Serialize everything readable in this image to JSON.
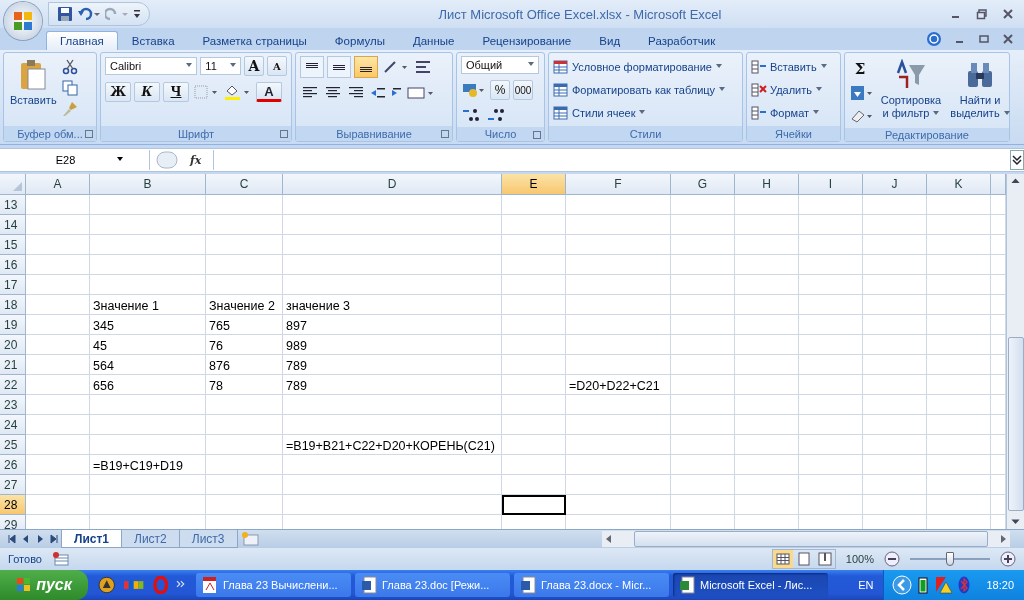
{
  "window": {
    "title": "Лист Microsoft Office Excel.xlsx - Microsoft Excel"
  },
  "tabs": [
    {
      "label": "Главная",
      "selected": true
    },
    {
      "label": "Вставка",
      "selected": false
    },
    {
      "label": "Разметка страницы",
      "selected": false
    },
    {
      "label": "Формулы",
      "selected": false
    },
    {
      "label": "Данные",
      "selected": false
    },
    {
      "label": "Рецензирование",
      "selected": false
    },
    {
      "label": "Вид",
      "selected": false
    },
    {
      "label": "Разработчик",
      "selected": false
    }
  ],
  "ribbon": {
    "clipboard": {
      "paste": "Вставить",
      "label": "Буфер обм..."
    },
    "font": {
      "name": "Calibri",
      "size": "11",
      "grow": "A",
      "shrink": "A",
      "bold": "Ж",
      "italic": "К",
      "underline": "Ч",
      "color_button": "A",
      "label": "Шрифт"
    },
    "alignment": {
      "vertical": [
        {
          "selected": false
        },
        {
          "selected": false
        },
        {
          "selected": true
        }
      ],
      "label": "Выравнивание"
    },
    "number": {
      "format": "Общий",
      "percent": "%",
      "thousands": "000",
      "label": "Число"
    },
    "styles": {
      "items": [
        "Условное форматирование",
        "Форматировать как таблицу",
        "Стили ячеек"
      ],
      "label": "Стили"
    },
    "cells": {
      "items": [
        "Вставить",
        "Удалить",
        "Формат"
      ],
      "label": "Ячейки"
    },
    "editing": {
      "sum": "Σ",
      "sort": "Сортировка и фильтр",
      "find": "Найти и выделить",
      "label": "Редактирование"
    }
  },
  "formula_bar": {
    "name_box": "E28",
    "fx": "fx"
  },
  "columns": [
    {
      "label": "A",
      "selected": false
    },
    {
      "label": "B",
      "selected": false
    },
    {
      "label": "C",
      "selected": false
    },
    {
      "label": "D",
      "selected": false
    },
    {
      "label": "E",
      "selected": true
    },
    {
      "label": "F",
      "selected": false
    },
    {
      "label": "G",
      "selected": false
    },
    {
      "label": "H",
      "selected": false
    },
    {
      "label": "I",
      "selected": false
    },
    {
      "label": "J",
      "selected": false
    },
    {
      "label": "K",
      "selected": false
    }
  ],
  "rows": [
    {
      "number": "13",
      "selected": false
    },
    {
      "number": "14",
      "selected": false
    },
    {
      "number": "15",
      "selected": false
    },
    {
      "number": "16",
      "selected": false
    },
    {
      "number": "17",
      "selected": false
    },
    {
      "number": "18",
      "selected": false,
      "cells": {
        "B": "Значение 1",
        "C": "Значение 2",
        "D": "значение 3"
      }
    },
    {
      "number": "19",
      "selected": false,
      "cells": {
        "B": "345",
        "C": "765",
        "D": "897"
      }
    },
    {
      "number": "20",
      "selected": false,
      "cells": {
        "B": "45",
        "C": "76",
        "D": "989"
      }
    },
    {
      "number": "21",
      "selected": false,
      "cells": {
        "B": "564",
        "C": "876",
        "D": "789"
      }
    },
    {
      "number": "22",
      "selected": false,
      "cells": {
        "B": "656",
        "C": "78",
        "D": "789",
        "F": "=D20+D22+C21"
      }
    },
    {
      "number": "23",
      "selected": false
    },
    {
      "number": "24",
      "selected": false
    },
    {
      "number": "25",
      "selected": false,
      "cells": {
        "D": "=B19+B21+C22+D20+КОРЕНЬ(C21)"
      }
    },
    {
      "number": "26",
      "selected": false,
      "cells": {
        "B": "=B19+C19+D19"
      }
    },
    {
      "number": "27",
      "selected": false
    },
    {
      "number": "28",
      "selected": true
    },
    {
      "number": "29",
      "selected": false
    }
  ],
  "sheets": [
    {
      "label": "Лист1",
      "selected": true
    },
    {
      "label": "Лист2",
      "selected": false
    },
    {
      "label": "Лист3",
      "selected": false
    }
  ],
  "status_bar": {
    "text": "Готово",
    "zoom": "100%",
    "zoom_slider": {
      "level": 0.5
    }
  },
  "taskbar": {
    "start": "пуск",
    "tasks": [
      {
        "label": "Глава 23 Вычислени...",
        "selected": false,
        "kind": "pdf"
      },
      {
        "label": "Глава 23.doc [Режи...",
        "selected": false,
        "kind": "word"
      },
      {
        "label": "Глава 23.docx - Micr...",
        "selected": false,
        "kind": "word"
      },
      {
        "label": "Microsoft Excel - Лис...",
        "selected": true,
        "kind": "excel"
      }
    ],
    "language": "EN",
    "clock": "18:20"
  }
}
